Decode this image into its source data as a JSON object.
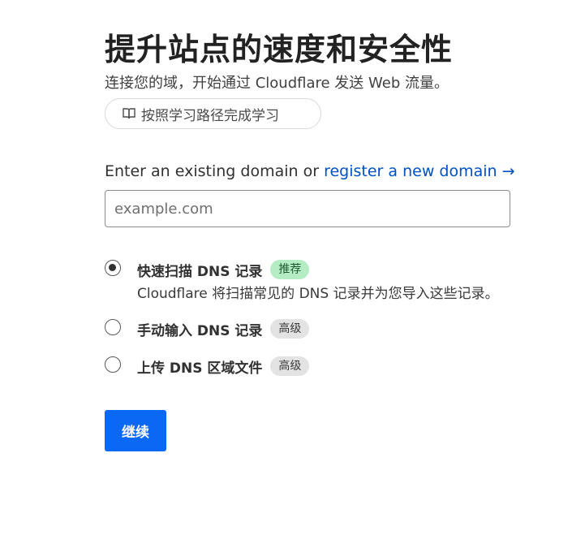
{
  "header": {
    "title": "提升站点的速度和安全性",
    "subtitle": "连接您的域，开始通过 Cloudflare 发送 Web 流量。",
    "learn_button_label": "按照学习路径完成学习",
    "learn_button_icon": "book-icon"
  },
  "domain": {
    "label_prefix": "Enter an existing domain or ",
    "register_link": "register a new domain",
    "register_arrow": "→",
    "placeholder": "example.com",
    "value": ""
  },
  "options": [
    {
      "title": "快速扫描 DNS 记录",
      "badge": "推荐",
      "badge_color": "#b5ecc4",
      "description": "Cloudflare 将扫描常见的 DNS 记录并为您导入这些记录。",
      "selected": true
    },
    {
      "title": "手动输入 DNS 记录",
      "badge": "高级",
      "badge_color": "#e3e3e3",
      "selected": false
    },
    {
      "title": "上传 DNS 区域文件",
      "badge": "高级",
      "badge_color": "#e3e3e3",
      "selected": false
    }
  ],
  "actions": {
    "continue_label": "继续",
    "continue_color": "#0969f5"
  }
}
